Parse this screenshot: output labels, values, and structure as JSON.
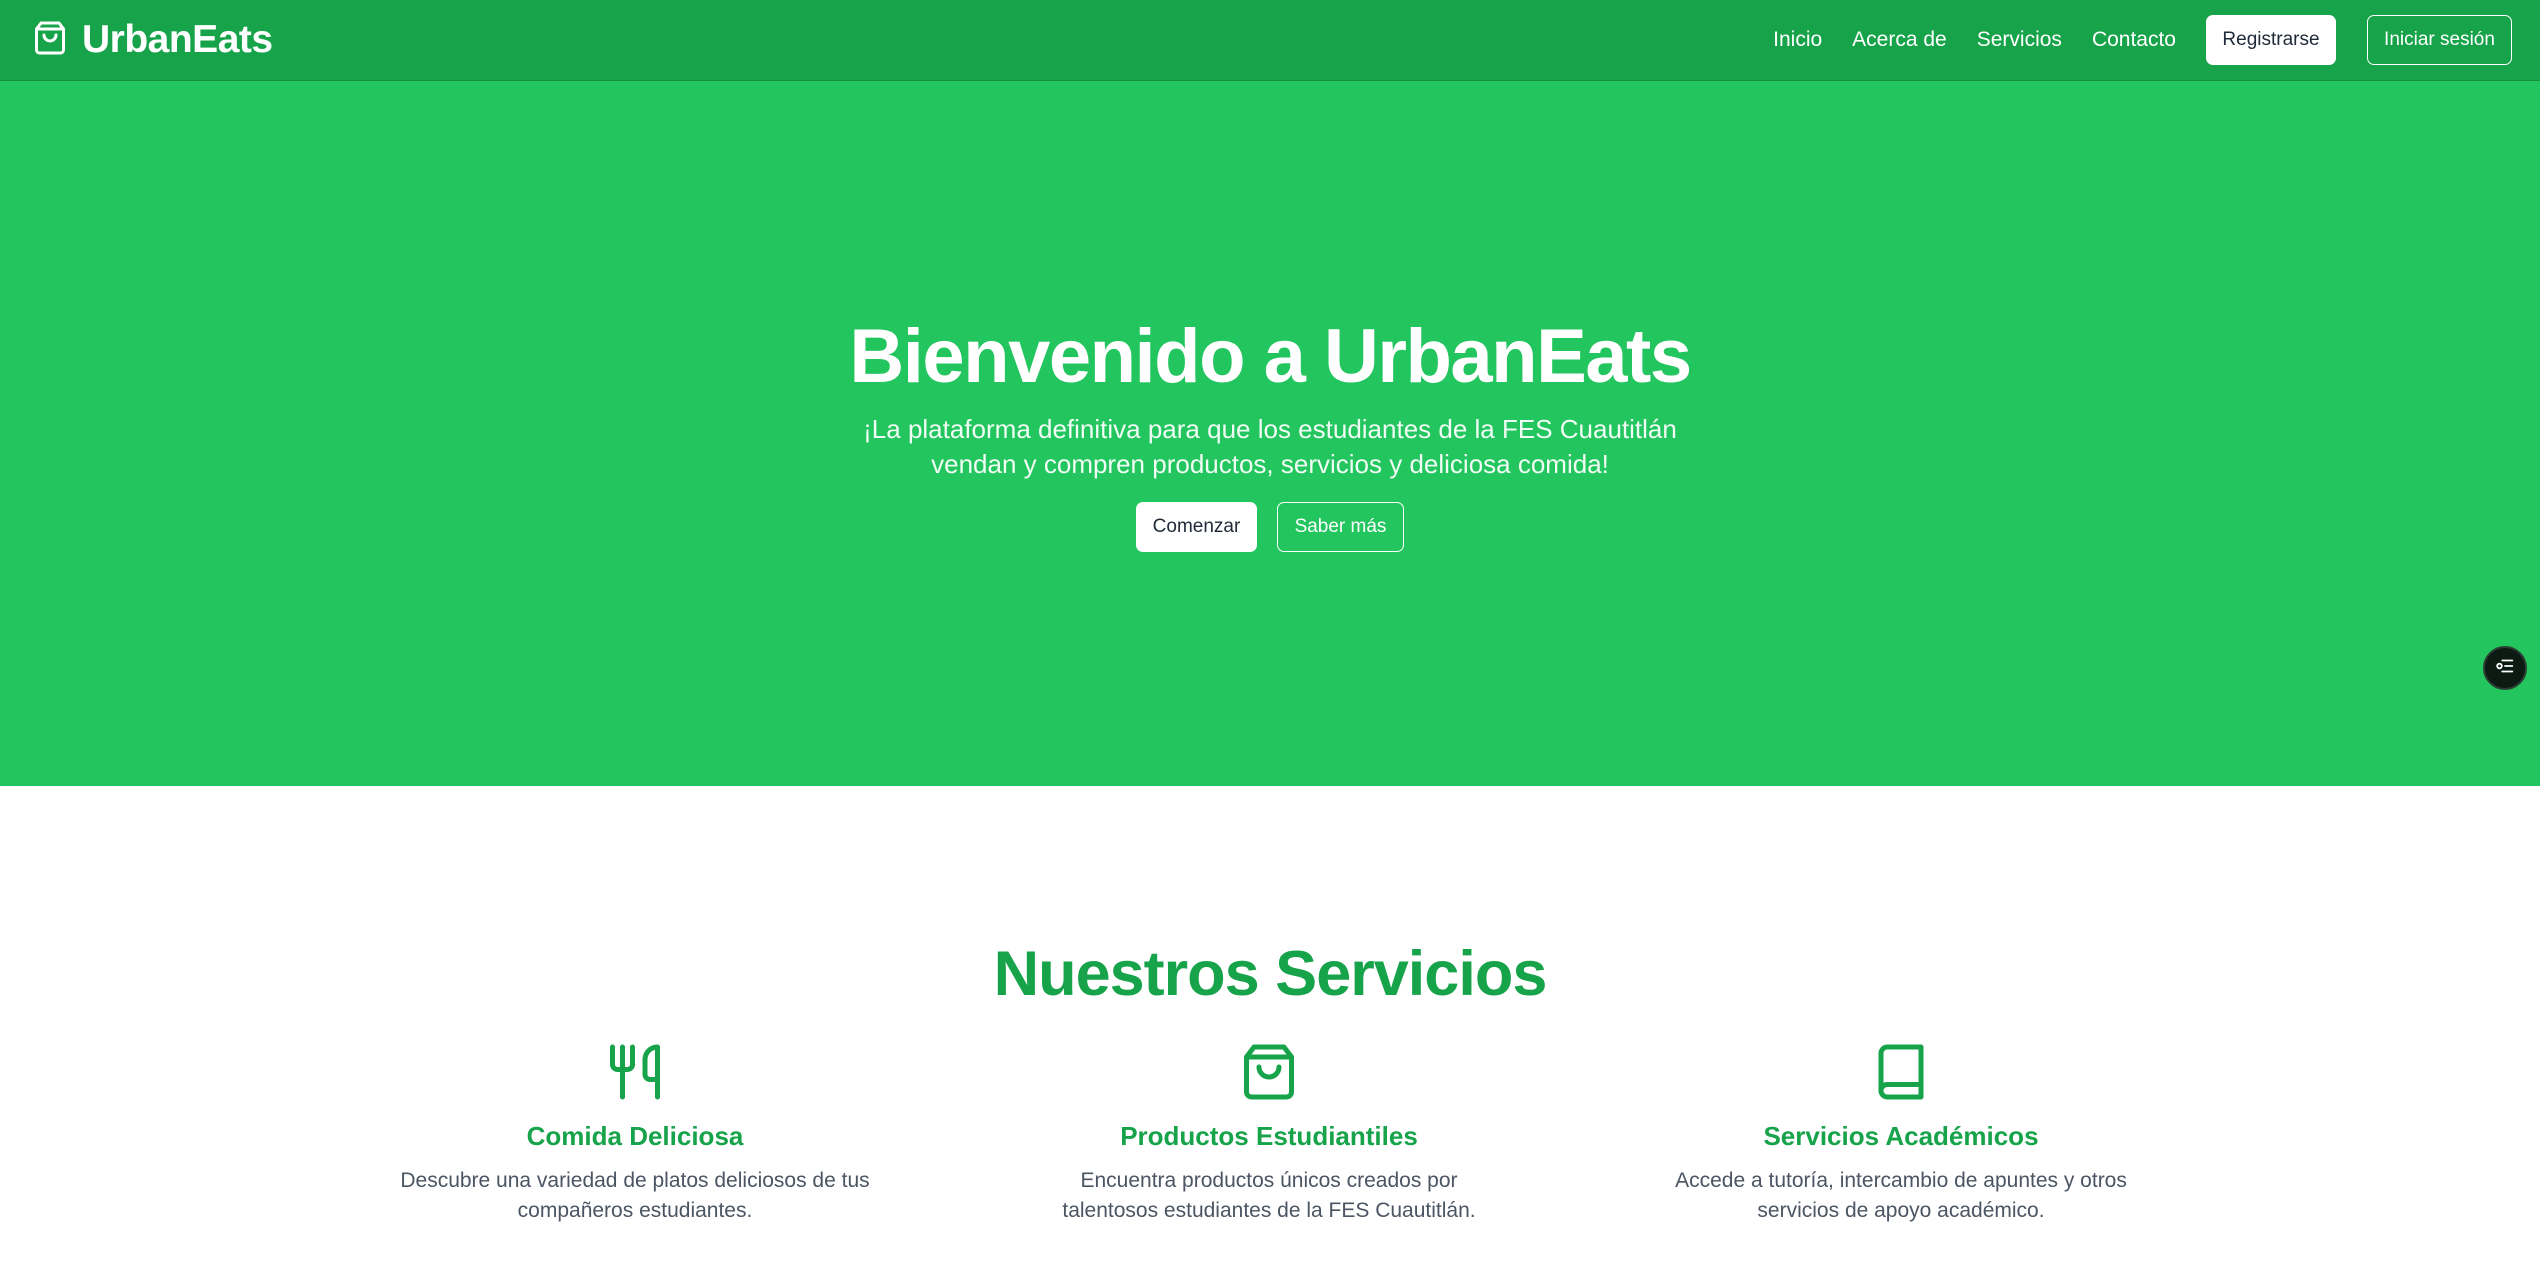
{
  "navbar": {
    "brand": "UrbanEats",
    "brand_icon": "shopping-bag-icon",
    "links": [
      "Inicio",
      "Acerca de",
      "Servicios",
      "Contacto"
    ],
    "register_label": "Registrarse",
    "login_label": "Iniciar sesión"
  },
  "hero": {
    "title": "Bienvenido a UrbanEats",
    "subtitle": "¡La plataforma definitiva para que los estudiantes de la FES Cuautitlán vendan y compren productos, servicios y deliciosa comida!",
    "start_label": "Comenzar",
    "more_label": "Saber más"
  },
  "services": {
    "title": "Nuestros Servicios",
    "items": [
      {
        "icon": "utensils-icon",
        "name": "Comida Deliciosa",
        "description": "Descubre una variedad de platos deliciosos de tus compañeros estudiantes."
      },
      {
        "icon": "shopping-bag-icon",
        "name": "Productos Estudiantiles",
        "description": "Encuentra productos únicos creados por talentosos estudiantes de la FES Cuautitlán."
      },
      {
        "icon": "book-icon",
        "name": "Servicios Académicos",
        "description": "Accede a tutoría, intercambio de apuntes y otros servicios de apoyo académico."
      }
    ]
  },
  "colors": {
    "nav_bg": "#16a34a",
    "hero_bg": "#22c55e",
    "accent": "#16a34a",
    "body_text": "#4b5563"
  },
  "floating_button_icon": "list-settings-icon"
}
